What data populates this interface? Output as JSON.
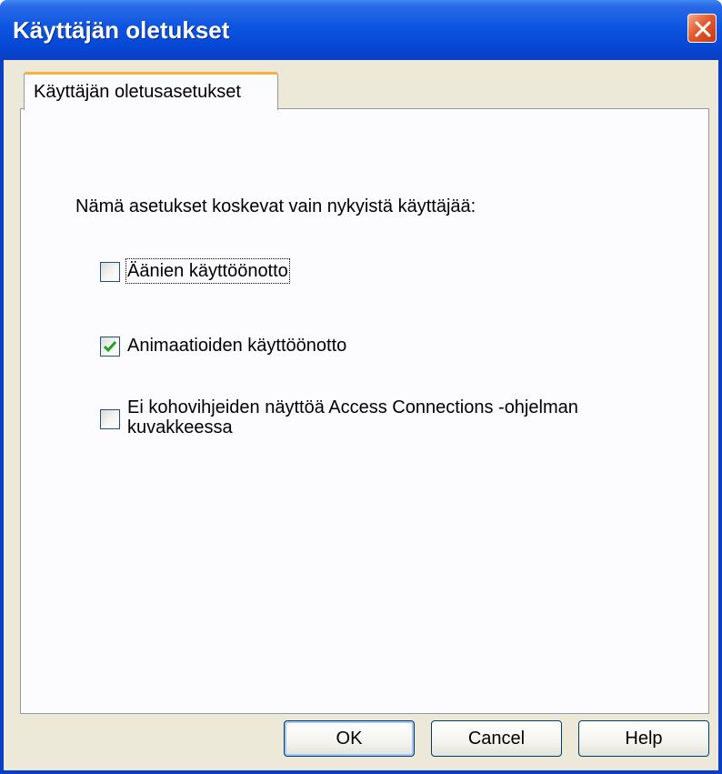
{
  "window": {
    "title": "Käyttäjän oletukset"
  },
  "tabs": [
    {
      "label": "Käyttäjän oletusasetukset",
      "selected": true
    }
  ],
  "intro_text": "Nämä asetukset koskevat vain nykyistä käyttäjää:",
  "options": [
    {
      "label": "Äänien käyttöönotto",
      "checked": false
    },
    {
      "label": "Animaatioiden käyttöönotto",
      "checked": true
    },
    {
      "label_line1": "Ei kohovihjeiden näyttöä Access Connections -ohjelman",
      "label_line2": "kuvakkeessa",
      "checked": false
    }
  ],
  "buttons": {
    "ok": "OK",
    "cancel": "Cancel",
    "help": "Help"
  },
  "colors": {
    "titlebar": "#0a3fc4",
    "dialog_face": "#ece9d8",
    "tab_highlight": "#f7b03d",
    "checkmark": "#21a121",
    "close_button": "#e35a2e"
  },
  "icons": {
    "close": "close-icon",
    "checkmark": "checkmark-icon"
  }
}
